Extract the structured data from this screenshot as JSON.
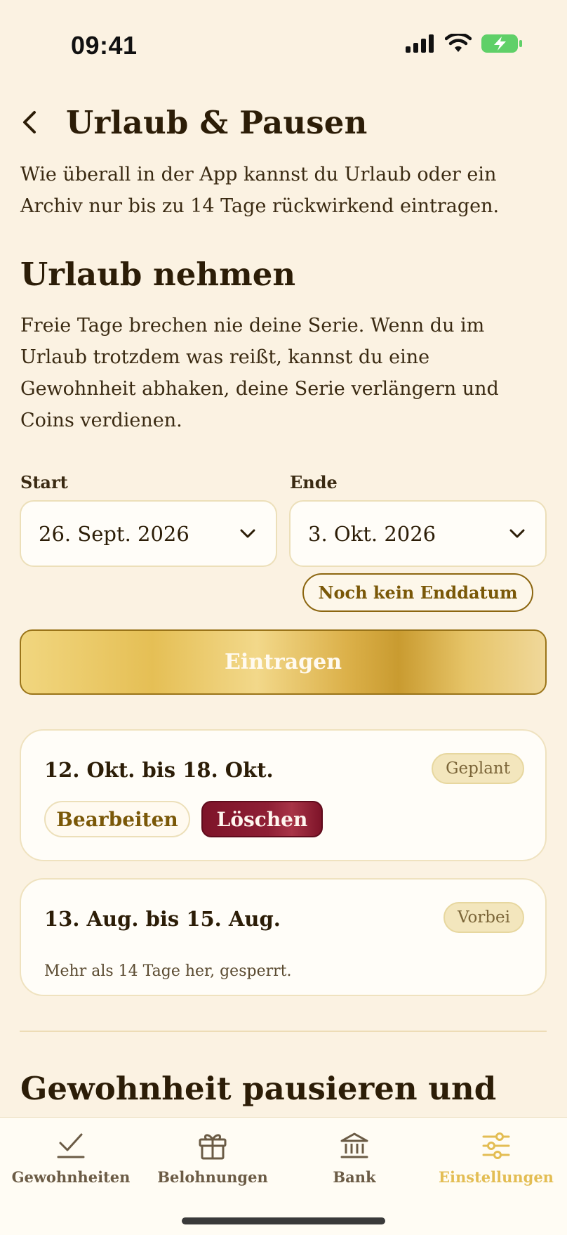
{
  "status_bar": {
    "time": "09:41"
  },
  "header": {
    "title": "Urlaub & Pausen"
  },
  "intro": "Wie überall in der App kannst du Urlaub oder ein Archiv nur bis zu 14 Tage rückwirkend eintragen.",
  "vacation": {
    "title": "Urlaub nehmen",
    "description": "Freie Tage brechen nie deine Serie. Wenn du im Urlaub trotzdem was reißt, kannst du eine Gewohnheit abhaken, deine Serie verlängern und Coins verdienen.",
    "start_label": "Start",
    "start_value": "26. Sept. 2026",
    "end_label": "Ende",
    "end_value": "3. Okt. 2026",
    "no_end_label": "Noch kein Enddatum",
    "submit_label": "Eintragen"
  },
  "entries": [
    {
      "range": "12. Okt. bis 18. Okt.",
      "status": "Geplant",
      "edit_label": "Bearbeiten",
      "delete_label": "Löschen"
    },
    {
      "range": "13. Aug. bis 15. Aug.",
      "status": "Vorbei",
      "note": "Mehr als 14 Tage her, gesperrt."
    }
  ],
  "pause_section": {
    "title": "Gewohnheit pausieren und"
  },
  "tabs": [
    {
      "label": "Gewohnheiten",
      "icon": "checkmark-icon",
      "active": false
    },
    {
      "label": "Belohnungen",
      "icon": "gift-icon",
      "active": false
    },
    {
      "label": "Bank",
      "icon": "bank-icon",
      "active": false
    },
    {
      "label": "Einstellungen",
      "icon": "sliders-icon",
      "active": true
    }
  ],
  "colors": {
    "background": "#fbf2e2",
    "accent_gold": "#e3bd53",
    "delete_red": "#8e1f35",
    "text": "#2c1d07"
  }
}
